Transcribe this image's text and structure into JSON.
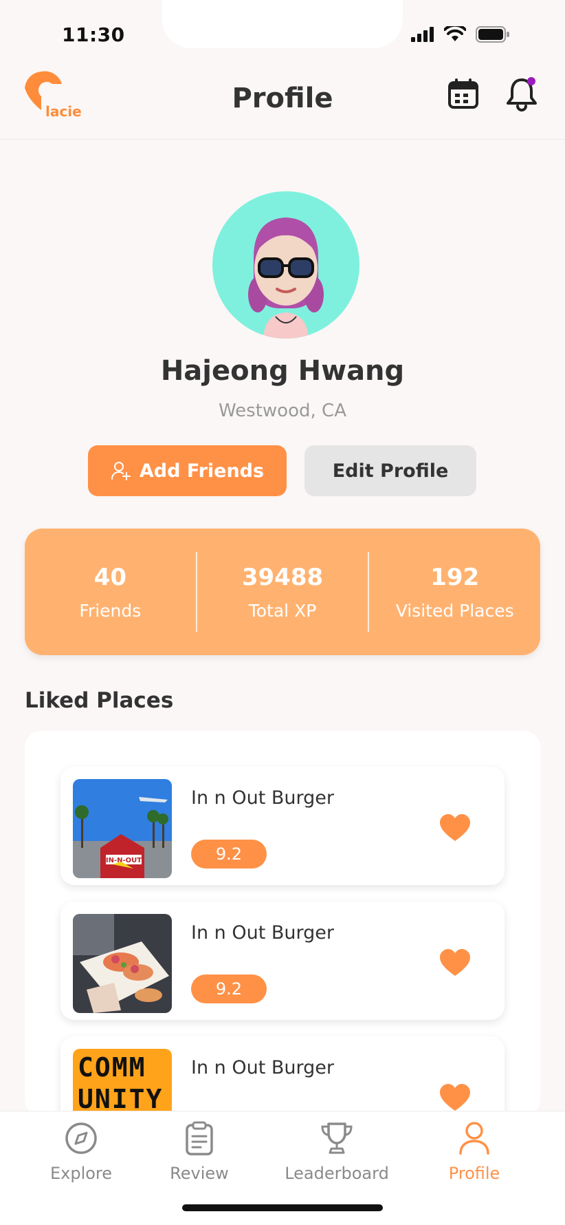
{
  "status_bar": {
    "time": "11:30"
  },
  "header": {
    "logo_text": "lacie",
    "title": "Profile"
  },
  "profile": {
    "name": "Hajeong Hwang",
    "location": "Westwood, CA",
    "add_friends_label": "Add Friends",
    "edit_profile_label": "Edit Profile"
  },
  "stats": [
    {
      "value": "40",
      "label": "Friends"
    },
    {
      "value": "39488",
      "label": "Total XP"
    },
    {
      "value": "192",
      "label": "Visited Places"
    }
  ],
  "liked_places": {
    "title": "Liked Places",
    "items": [
      {
        "name": "In n Out Burger",
        "rating": "9.2",
        "thumb_text": "IN-N-OUT"
      },
      {
        "name": "In n Out Burger",
        "rating": "9.2",
        "thumb_text": ""
      },
      {
        "name": "In n Out Burger",
        "rating": "",
        "thumb_text": "COMM UNITY"
      }
    ]
  },
  "tabs": [
    {
      "label": "Explore",
      "icon": "compass-icon",
      "active": false
    },
    {
      "label": "Review",
      "icon": "clipboard-icon",
      "active": false
    },
    {
      "label": "Leaderboard",
      "icon": "trophy-icon",
      "active": false
    },
    {
      "label": "Profile",
      "icon": "person-icon",
      "active": true
    }
  ],
  "colors": {
    "accent": "#ff9147",
    "stats_bg": "#ffb270",
    "avatar_bg": "#7ff0dd",
    "notification_dot": "#9b1bbf"
  }
}
